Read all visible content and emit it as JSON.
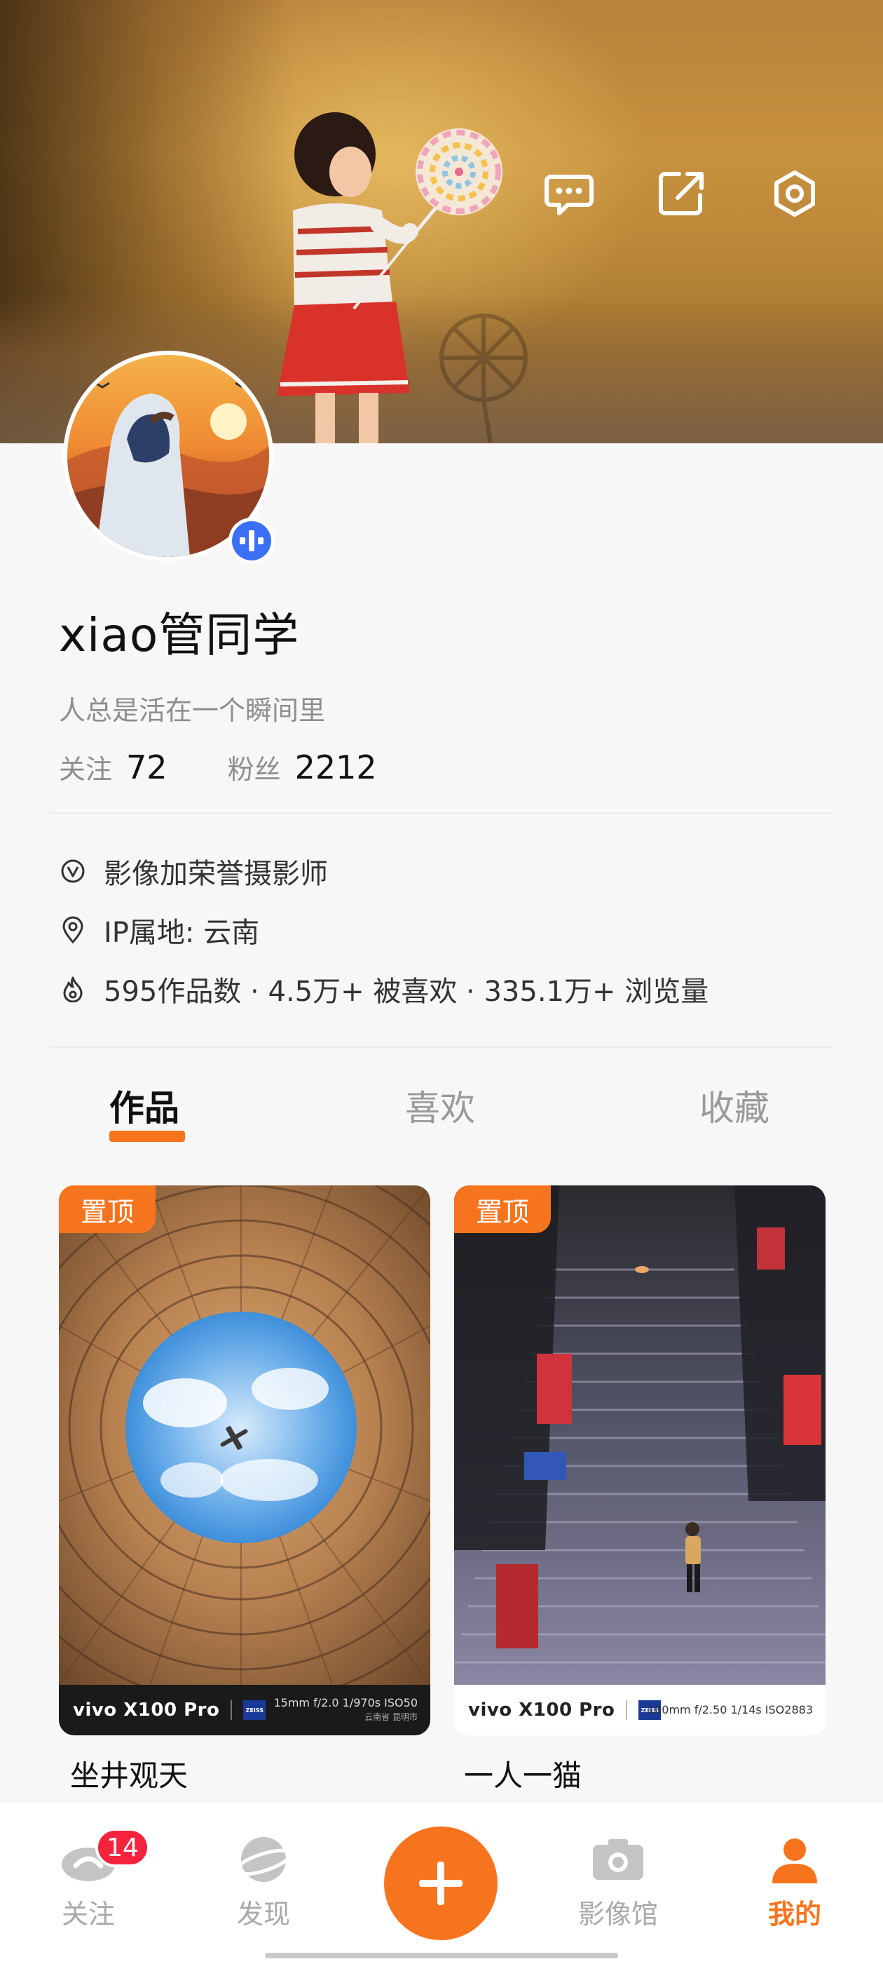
{
  "header": {
    "icons": [
      "message-icon",
      "share-icon",
      "settings-icon"
    ]
  },
  "profile": {
    "username": "xiao管同学",
    "bio": "人总是活在一个瞬间里",
    "following_label": "关注",
    "following_count": "72",
    "followers_label": "粉丝",
    "followers_count": "2212"
  },
  "info": {
    "honor": "影像加荣誉摄影师",
    "ip_location": "IP属地: 云南",
    "stats": "595作品数 · 4.5万+ 被喜欢 · 335.1万+ 浏览量"
  },
  "tabs": [
    {
      "label": "作品",
      "active": true
    },
    {
      "label": "喜欢",
      "active": false
    },
    {
      "label": "收藏",
      "active": false
    }
  ],
  "posts": [
    {
      "pin_label": "置顶",
      "title": "坐井观天",
      "watermark_brand": "vivo X100 Pro",
      "watermark_params": "15mm  f/2.0  1/970s  ISO50",
      "watermark_location": "云南省 昆明市"
    },
    {
      "pin_label": "置顶",
      "title": "一人一猫",
      "watermark_brand": "vivo X100 Pro",
      "watermark_params": "100mm  f/2.50  1/14s  ISO2883",
      "watermark_location": ""
    }
  ],
  "bottom_nav": {
    "items": [
      {
        "label": "关注",
        "badge": "14",
        "icon": "follow-eye-icon"
      },
      {
        "label": "发现",
        "icon": "planet-icon"
      },
      {
        "label": "影像馆",
        "icon": "camera-icon"
      },
      {
        "label": "我的",
        "icon": "person-icon",
        "active": true
      }
    ],
    "fab_icon": "plus-icon"
  },
  "colors": {
    "accent": "#f7741e",
    "badge": "#f5243d",
    "verified": "#3b6ff5"
  }
}
